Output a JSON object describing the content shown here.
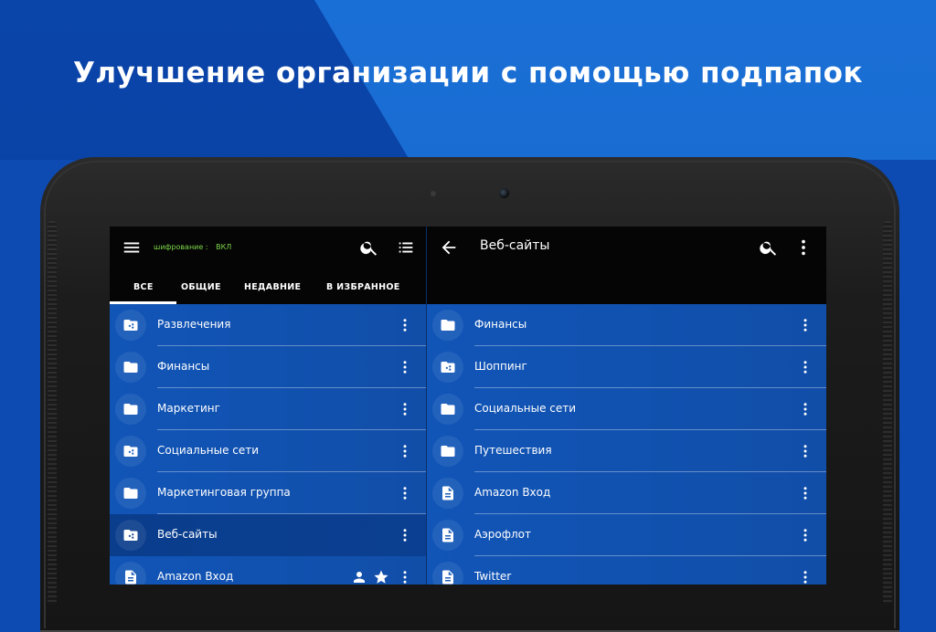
{
  "headline": "Улучшение организации с помощью подпапок",
  "left_pane": {
    "encryption_label": "шифрование :",
    "encryption_value": "ВКЛ",
    "tabs": [
      {
        "label": "ВСЕ"
      },
      {
        "label": "ОБЩИЕ"
      },
      {
        "label": "НЕДАВНИЕ"
      },
      {
        "label": "В ИЗБРАННОЕ"
      }
    ],
    "items": [
      {
        "label": "Развлечения",
        "icon": "shared-folder-icon"
      },
      {
        "label": "Финансы",
        "icon": "folder-icon"
      },
      {
        "label": "Маркетинг",
        "icon": "folder-icon"
      },
      {
        "label": "Социальные сети",
        "icon": "shared-folder-icon"
      },
      {
        "label": "Маркетинговая группа",
        "icon": "folder-icon"
      },
      {
        "label": "Веб-сайты",
        "icon": "shared-folder-icon"
      },
      {
        "label": "Amazon Вход",
        "icon": "document-icon"
      }
    ]
  },
  "right_pane": {
    "title": "Веб-сайты",
    "items": [
      {
        "label": "Финансы",
        "icon": "folder-icon"
      },
      {
        "label": "Шоппинг",
        "icon": "shared-folder-icon"
      },
      {
        "label": "Социальные сети",
        "icon": "folder-icon"
      },
      {
        "label": "Путешествия",
        "icon": "folder-icon"
      },
      {
        "label": "Amazon Вход",
        "icon": "document-icon"
      },
      {
        "label": "Аэрофлот",
        "icon": "document-icon"
      },
      {
        "label": "Twitter",
        "icon": "document-icon"
      }
    ]
  }
}
